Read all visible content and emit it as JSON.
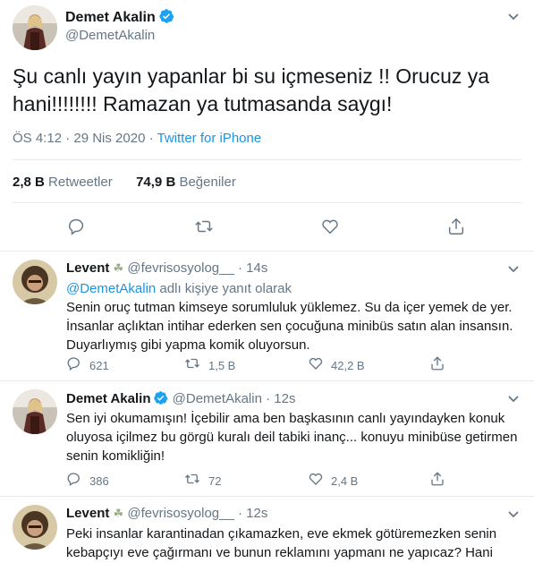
{
  "main": {
    "name": "Demet Akalin",
    "handle": "@DemetAkalin",
    "text": "Şu canlı yayın yapanlar bi su içmeseniz !! Orucuz ya hani!!!!!!!! Ramazan ya tutmasanda saygı!",
    "time": "ÖS 4:12 · 29 Nis 2020 · ",
    "source": "Twitter for iPhone",
    "retweets_count": "2,8 B",
    "retweets_label": "Retweetler",
    "likes_count": "74,9 B",
    "likes_label": "Beğeniler"
  },
  "replies": [
    {
      "name": "Levent",
      "handle": "@fevrisosyolog__",
      "time": "14s",
      "reply_to_mention": "@DemetAkalin",
      "reply_to_suffix": " adlı kişiye yanıt olarak",
      "text": "Senin oruç tutman kimseye sorumluluk yüklemez. Su da içer yemek de yer. İnsanlar açlıktan intihar ederken sen çocuğuna minibüs satın alan insansın. Duyarlıymış gibi yapma komik oluyorsun.",
      "replies": "621",
      "retweets": "1,5 B",
      "likes": "42,2 B"
    },
    {
      "name": "Demet Akalin",
      "handle": "@DemetAkalin",
      "time": "12s",
      "text": "Sen iyi okumamışın! İçebilir ama ben başkasının canlı yayındayken konuk oluyosa içilmez bu görgü kuralı deil tabiki inanç... konuyu minibüse getirmen senin komikliğin!",
      "replies": "386",
      "retweets": "72",
      "likes": "2,4 B"
    },
    {
      "name": "Levent",
      "handle": "@fevrisosyolog__",
      "time": "12s",
      "text": "Peki insanlar karantinadan çıkamazken, eve ekmek götüremezken senin kebapçıyı eve çağırmanı ve bunun reklamını yapmanı ne yapıcaz? Hani saygı!"
    }
  ],
  "icons": [
    "reply-icon",
    "retweet-icon",
    "like-icon",
    "share-icon",
    "chevron-down-icon",
    "verified-badge-icon",
    "dove-emoji-icon"
  ],
  "colors": {
    "accent": "#1b95e0",
    "muted": "#657786",
    "text": "#14171a",
    "divider": "#e6ecf0",
    "verified": "#1da1f2"
  }
}
